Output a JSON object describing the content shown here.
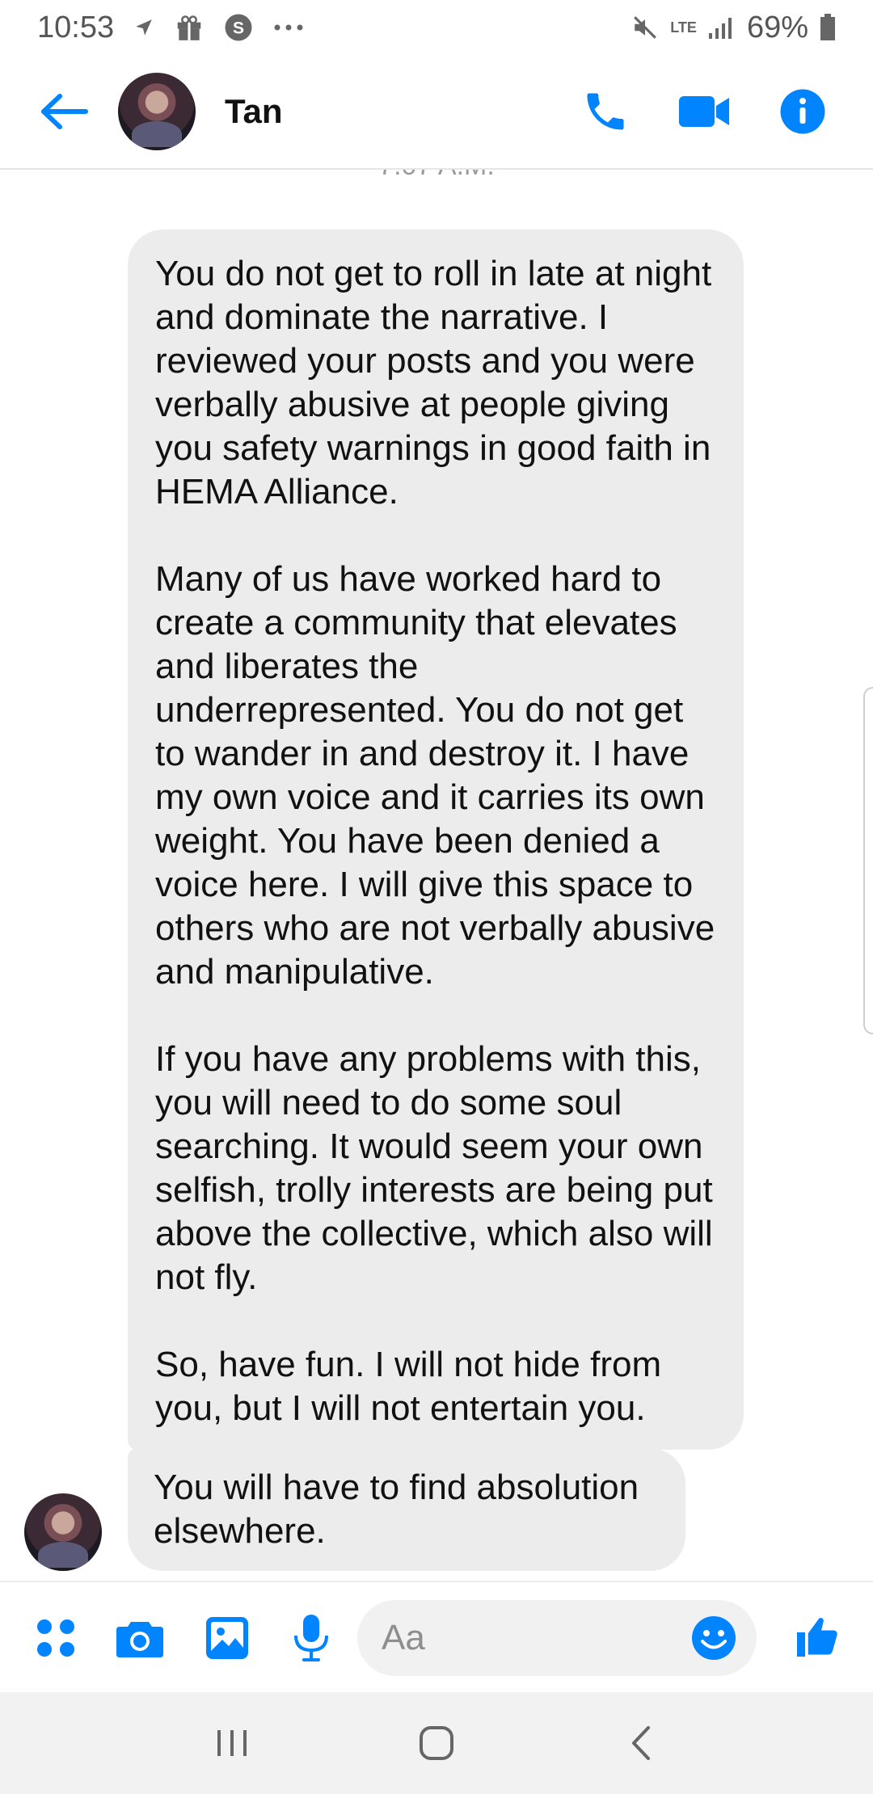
{
  "status_bar": {
    "time": "10:53",
    "network": "LTE",
    "battery": "69%"
  },
  "header": {
    "contact_name": "Tan",
    "accent_color": "#0084ff"
  },
  "thread": {
    "timestamp": "7:07 A.M.",
    "messages": [
      {
        "text": "You do not get to roll in late at night and dominate the narrative. I reviewed your posts and you were verbally abusive at people giving you safety warnings in good faith in HEMA Alliance.\n\nMany of us have worked hard to create a community that elevates and liberates the underrepresented. You do not get to wander in and destroy it. I have my own voice and it carries its own weight. You have been denied a voice here. I will give this space to others who are not verbally abusive and manipulative.\n\nIf you have any problems with this, you will need to do some soul searching. It would seem your own selfish, trolly interests are being put above the collective, which also will not fly.\n\nSo, have fun. I will not hide from you, but I will not entertain you."
      },
      {
        "text": "You will have to find absolution elsewhere."
      }
    ]
  },
  "composer": {
    "placeholder": "Aa"
  },
  "icons": {
    "status": [
      "navigation-icon",
      "gift-icon",
      "skype-icon",
      "more-dots-icon",
      "mute-icon",
      "signal-icon",
      "battery-icon"
    ],
    "header": [
      "back-arrow-icon",
      "phone-icon",
      "video-camera-icon",
      "info-icon"
    ],
    "composer": [
      "apps-grid-icon",
      "camera-icon",
      "gallery-icon",
      "microphone-icon",
      "emoji-icon",
      "thumbs-up-icon"
    ],
    "nav": [
      "recents-icon",
      "home-icon",
      "back-icon"
    ]
  }
}
